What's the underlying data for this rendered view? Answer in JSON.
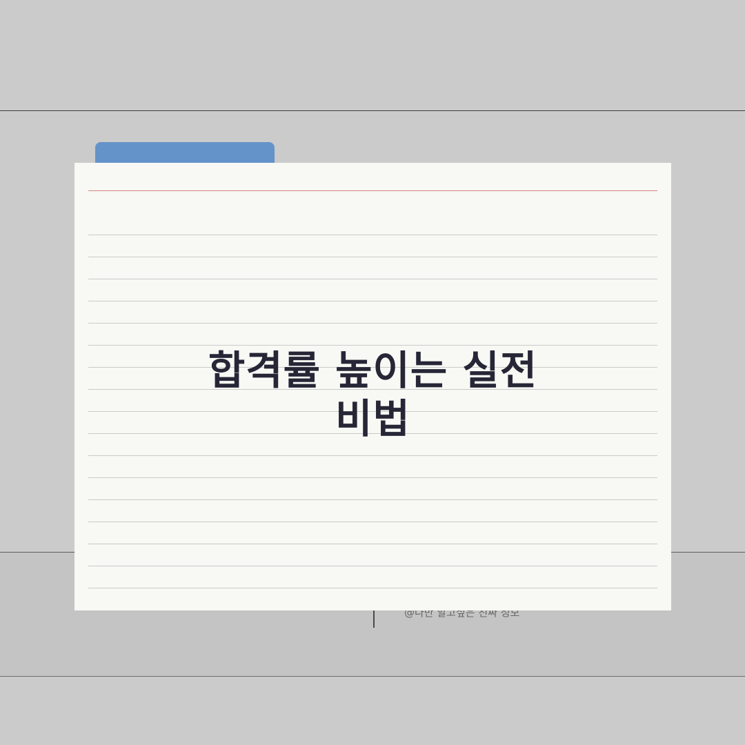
{
  "card": {
    "title_line1": "합격률 높이는 실전",
    "title_line2": "비법"
  },
  "footer": {
    "credit": "@나만 알고싶은 진짜 정보"
  },
  "colors": {
    "background": "#cbcbcb",
    "card": "#f8f8f4",
    "tab": "#6493c9",
    "margin_rule": "#d88080",
    "title_text": "#262637"
  }
}
